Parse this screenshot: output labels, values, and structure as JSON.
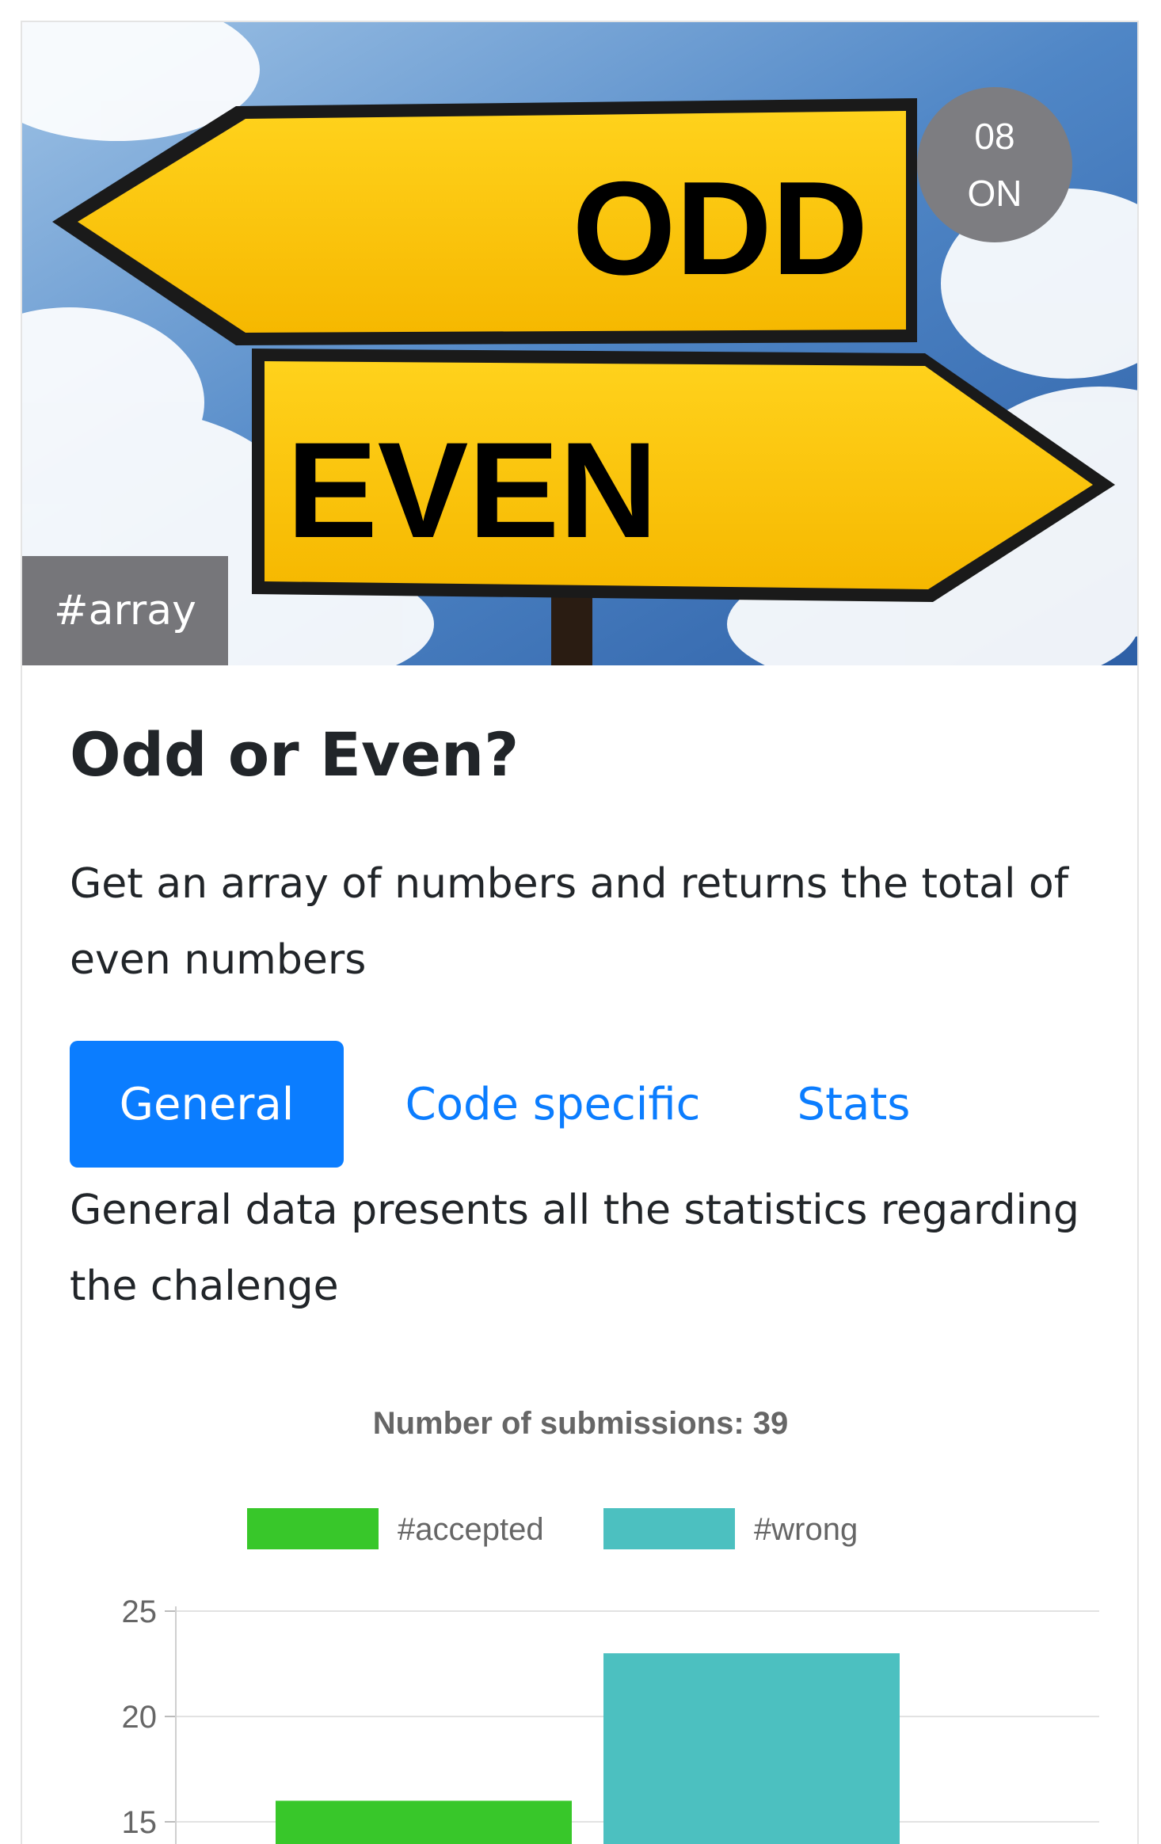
{
  "challenge": {
    "day_number": "08",
    "day_state": "ON",
    "tag": "#array",
    "hero_words": {
      "top_sign": "ODD",
      "bottom_sign": "EVEN"
    },
    "title": "Odd or Even?",
    "description": "Get an array of numbers and returns the total of even numbers"
  },
  "tabs": [
    {
      "label": "General",
      "active": true
    },
    {
      "label": "Code specific",
      "active": false
    },
    {
      "label": "Stats",
      "active": false
    }
  ],
  "tab_content": "General data presents all the statistics regarding the chalenge",
  "colors": {
    "accent": "#0b7dff",
    "accepted": "#38c72a",
    "wrong": "#4cc0c0",
    "badge": "#7d7d81"
  },
  "chart_data": {
    "type": "bar",
    "title": "Number of submissions: 39",
    "legend_position": "top",
    "grid": true,
    "yticks": [
      15,
      20,
      25
    ],
    "ylim_visible": [
      15,
      25
    ],
    "series": [
      {
        "name": "#accepted",
        "values": [
          16
        ],
        "color": "#38c72a"
      },
      {
        "name": "#wrong",
        "values": [
          23
        ],
        "color": "#4cc0c0"
      }
    ]
  }
}
